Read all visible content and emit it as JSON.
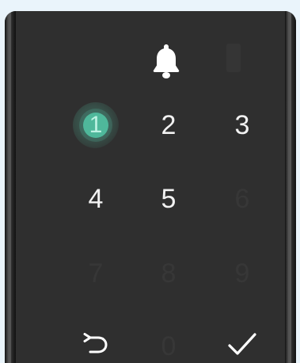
{
  "keypad": {
    "keys": [
      "1",
      "2",
      "3",
      "4",
      "5",
      "6",
      "7",
      "8",
      "9",
      "0"
    ]
  },
  "colors": {
    "background": "#eaf4fb",
    "device": "#2d2d2d",
    "highlight": "#4fb89b",
    "text": "#f2f2f2"
  },
  "icons": {
    "bell": "bell-icon",
    "back": "undo-arrow-icon",
    "confirm": "checkmark-icon"
  }
}
